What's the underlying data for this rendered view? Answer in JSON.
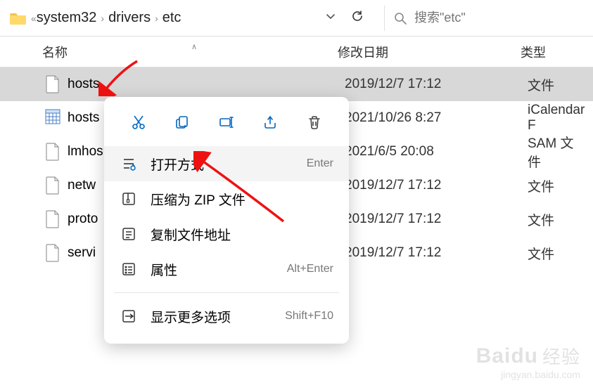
{
  "toolbar": {
    "breadcrumb": [
      "system32",
      "drivers",
      "etc"
    ],
    "search_placeholder": "搜索\"etc\""
  },
  "columns": {
    "name": "名称",
    "date": "修改日期",
    "type": "类型"
  },
  "files": [
    {
      "name": "hosts",
      "date": "2019/12/7 17:12",
      "type": "文件",
      "icon": "file",
      "selected": true
    },
    {
      "name": "hosts",
      "date": "2021/10/26 8:27",
      "type": "iCalendar F",
      "icon": "ical",
      "selected": false
    },
    {
      "name": "lmhos",
      "date": "2021/6/5 20:08",
      "type": "SAM 文件",
      "icon": "file",
      "selected": false
    },
    {
      "name": "netw",
      "date": "2019/12/7 17:12",
      "type": "文件",
      "icon": "file",
      "selected": false
    },
    {
      "name": "proto",
      "date": "2019/12/7 17:12",
      "type": "文件",
      "icon": "file",
      "selected": false
    },
    {
      "name": "servi",
      "date": "2019/12/7 17:12",
      "type": "文件",
      "icon": "file",
      "selected": false
    }
  ],
  "context_menu": {
    "items": [
      {
        "label": "打开方式",
        "shortcut": "Enter",
        "icon": "open-with",
        "highlight": true
      },
      {
        "label": "压缩为 ZIP 文件",
        "shortcut": "",
        "icon": "zip",
        "highlight": false
      },
      {
        "label": "复制文件地址",
        "shortcut": "",
        "icon": "copy-path",
        "highlight": false
      },
      {
        "label": "属性",
        "shortcut": "Alt+Enter",
        "icon": "properties",
        "highlight": false
      }
    ],
    "more_label": "显示更多选项",
    "more_shortcut": "Shift+F10"
  },
  "watermark": {
    "brand": "Baidu",
    "cn": "经验",
    "sub": "jingyan.baidu.com"
  }
}
